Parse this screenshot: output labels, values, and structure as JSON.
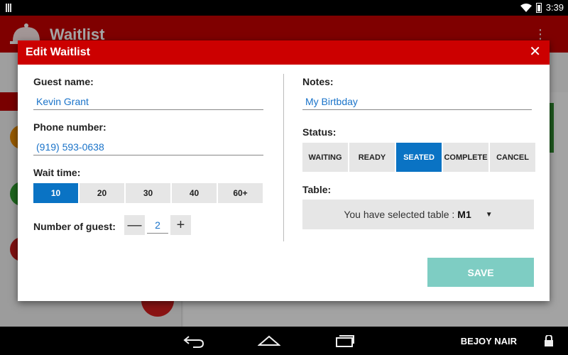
{
  "status_bar": {
    "time": "3:39"
  },
  "app": {
    "title": "Waitlist",
    "menu_icon": "overflow-menu-icon"
  },
  "dialog": {
    "title": "Edit Waitlist",
    "close_label": "✕",
    "guest_name": {
      "label": "Guest name:",
      "value": "Kevin Grant"
    },
    "phone": {
      "label": "Phone number:",
      "value": "(919) 593-0638"
    },
    "wait_time": {
      "label": "Wait time:",
      "options": [
        "10",
        "20",
        "30",
        "40",
        "60+"
      ],
      "selected": "10"
    },
    "guests": {
      "label": "Number of guest:",
      "minus": "—",
      "value": "2",
      "plus": "+"
    },
    "notes": {
      "label": "Notes:",
      "value": "My Birtbday"
    },
    "status": {
      "label": "Status:",
      "options": [
        "WAITING",
        "READY",
        "SEATED",
        "COMPLETE",
        "CANCEL"
      ],
      "selected": "SEATED"
    },
    "table": {
      "label": "Table:",
      "prefix": "You have selected table :",
      "value": "M1"
    },
    "save_label": "SAVE"
  },
  "nav": {
    "user": "BEJOY NAIR"
  },
  "colors": {
    "header_red": "#cc0000",
    "accent_blue": "#0a73c4",
    "save_teal": "#7ecdc3"
  }
}
